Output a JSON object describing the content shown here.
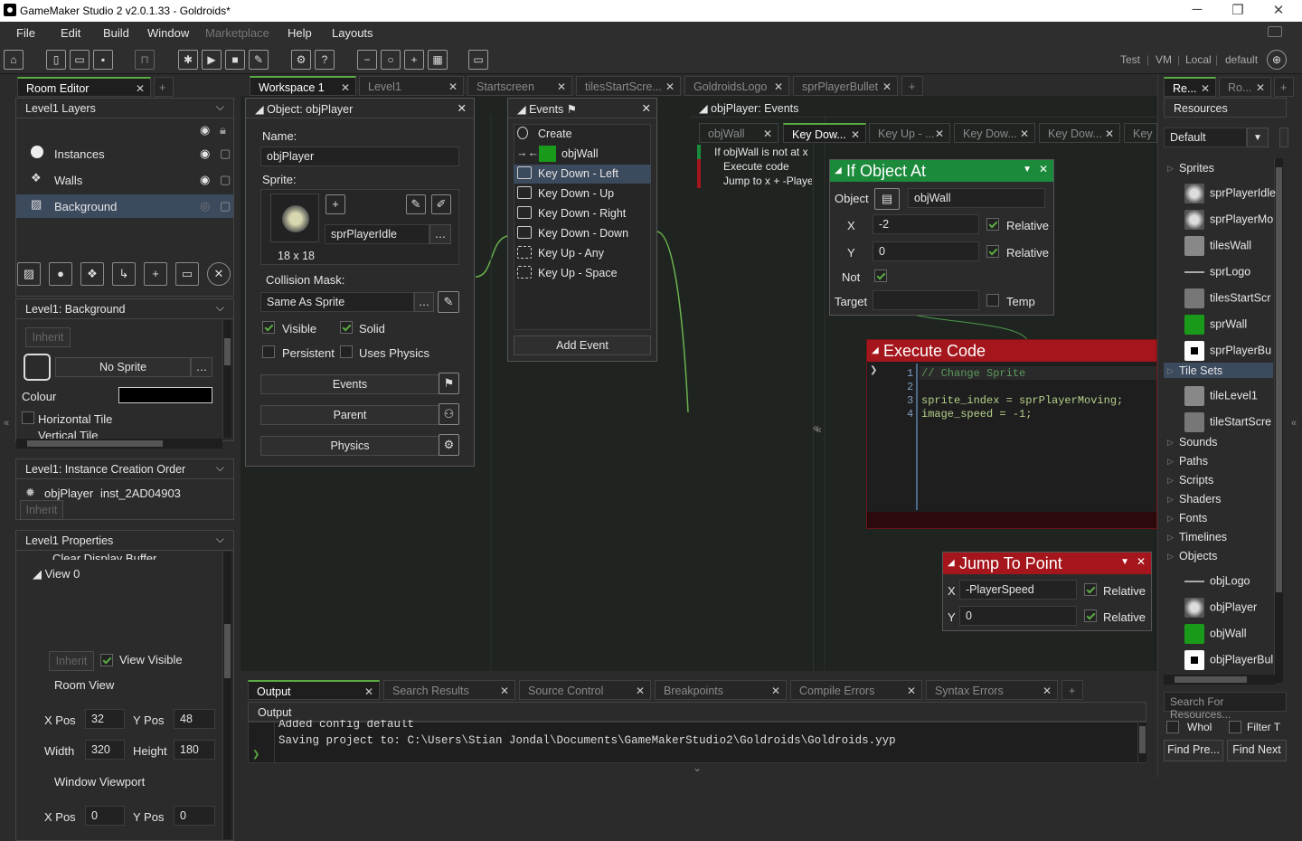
{
  "window": {
    "title": "GameMaker Studio 2   v2.0.1.33 - Goldroids*"
  },
  "menu": [
    "File",
    "Edit",
    "Build",
    "Window",
    "Marketplace",
    "Help",
    "Layouts"
  ],
  "target": {
    "test": "Test",
    "vm": "VM",
    "local": "Local",
    "default": "default"
  },
  "left_tabs": {
    "room_editor": "Room Editor"
  },
  "layers": {
    "header": "Level1 Layers",
    "items": [
      "Instances",
      "Walls",
      "Background"
    ]
  },
  "background_props": {
    "header": "Level1: Background",
    "inherit": "Inherit",
    "sprite": "No Sprite",
    "colour": "Colour",
    "htile": "Horizontal Tile",
    "vtile": "Vertical Tile"
  },
  "creation_order": {
    "header": "Level1: Instance Creation Order",
    "obj": "objPlayer",
    "inst": "inst_2AD04903",
    "inherit": "Inherit"
  },
  "properties": {
    "header": "Level1 Properties",
    "clear": "Clear Display Buffer",
    "view": "View 0",
    "inherit": "Inherit",
    "view_visible": "View Visible",
    "room_view": "Room View",
    "xpos_lbl": "X Pos",
    "xpos": "32",
    "ypos_lbl": "Y Pos",
    "ypos": "48",
    "width_lbl": "Width",
    "width": "320",
    "height_lbl": "Height",
    "height": "180",
    "viewport": "Window Viewport",
    "vx_lbl": "X Pos",
    "vx": "0",
    "vy_lbl": "Y Pos",
    "vy": "0"
  },
  "workspace_tabs": [
    "Workspace 1",
    "Level1",
    "Startscreen",
    "tilesStartScre...",
    "GoldroidsLogo",
    "sprPlayerBullet"
  ],
  "object_panel": {
    "title": "Object: objPlayer",
    "name_lbl": "Name:",
    "name": "objPlayer",
    "sprite_lbl": "Sprite:",
    "sprite": "sprPlayerIdle",
    "size": "18 x 18",
    "mask_lbl": "Collision Mask:",
    "mask": "Same As Sprite",
    "visible": "Visible",
    "solid": "Solid",
    "persistent": "Persistent",
    "physics_chk": "Uses Physics",
    "events_btn": "Events",
    "parent_btn": "Parent",
    "physics_btn": "Physics"
  },
  "events_panel": {
    "title": "Events",
    "items": [
      "Create",
      "objWall",
      "Key Down - Left",
      "Key Down - Up",
      "Key Down - Right",
      "Key Down - Down",
      "Key Up - Any",
      "Key Up - Space"
    ],
    "add": "Add Event"
  },
  "obj_events": {
    "title": "objPlayer: Events",
    "tabs": [
      "objWall",
      "Key Dow...",
      "Key Up - ...",
      "Key Dow...",
      "Key Dow...",
      "Key D"
    ],
    "lines": [
      "If objWall is not at x",
      "Execute code",
      "Jump to x + -Playe"
    ]
  },
  "if_object": {
    "title": "If Object At",
    "object_lbl": "Object",
    "object": "objWall",
    "x_lbl": "X",
    "x": "-2",
    "y_lbl": "Y",
    "y": "0",
    "relative": "Relative",
    "not_lbl": "Not",
    "target_lbl": "Target",
    "temp": "Temp"
  },
  "exec_code": {
    "title": "Execute Code",
    "lines": [
      "// Change Sprite",
      "",
      "sprite_index = sprPlayerMoving;",
      "image_speed = -1;"
    ]
  },
  "jump": {
    "title": "Jump To Point",
    "x_lbl": "X",
    "x": "-PlayerSpeed",
    "y_lbl": "Y",
    "y": "0",
    "relative": "Relative"
  },
  "output": {
    "tabs": [
      "Output",
      "Search Results",
      "Source Control",
      "Breakpoints",
      "Compile Errors",
      "Syntax Errors"
    ],
    "header": "Output",
    "lines": [
      "Added config default",
      "Saving project to: C:\\Users\\Stian Jondal\\Documents\\GameMakerStudio2\\Goldroids\\Goldroids.yyp"
    ]
  },
  "resources": {
    "tabs": [
      "Re...",
      "Ro..."
    ],
    "header": "Resources",
    "filter": "Default",
    "sprites_lbl": "Sprites",
    "sprites": [
      "sprPlayerIdle",
      "sprPlayerMo",
      "tilesWall",
      "sprLogo",
      "tilesStartScre",
      "sprWall",
      "sprPlayerBul"
    ],
    "tilesets_lbl": "Tile Sets",
    "tilesets": [
      "tileLevel1",
      "tileStartScre"
    ],
    "cats": [
      "Sounds",
      "Paths",
      "Scripts",
      "Shaders",
      "Fonts",
      "Timelines"
    ],
    "objects_lbl": "Objects",
    "objects": [
      "objLogo",
      "objPlayer",
      "objWall",
      "objPlayerBul"
    ],
    "search": "Search For Resources...",
    "whole": "Whole W",
    "filter_t": "Filter T",
    "find_prev": "Find Pre...",
    "find_next": "Find Next"
  },
  "colors": {
    "accent": "#5aab43",
    "exec_red": "#a5161c",
    "if_green": "#1b8a3b",
    "selection": "#3c4a5e"
  }
}
